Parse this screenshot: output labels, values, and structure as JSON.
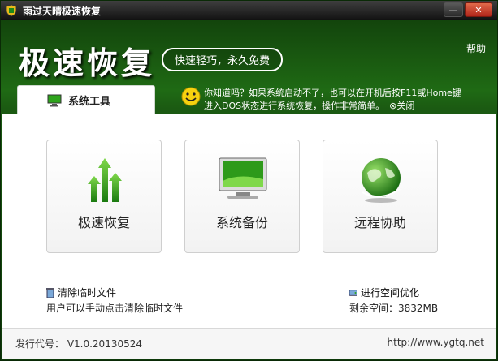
{
  "window": {
    "title": "雨过天晴极速恢复"
  },
  "header": {
    "brand": "极速恢复",
    "slogan": "快速轻巧，永久免费",
    "help": "帮助"
  },
  "tab": {
    "label": "系统工具"
  },
  "tip": {
    "line1": "你知道吗？如果系统启动不了，也可以在开机后按F11或Home键",
    "line2": "进入DOS状态进行系统恢复，操作非常简单。",
    "close": "⊗关闭"
  },
  "cards": [
    {
      "label": "极速恢复",
      "icon": "arrows-up-icon"
    },
    {
      "label": "系统备份",
      "icon": "computer-icon"
    },
    {
      "label": "远程协助",
      "icon": "globe-icon"
    }
  ],
  "cleanup": {
    "link": "清除临时文件",
    "desc": "用户可以手动点击清除临时文件"
  },
  "optimize": {
    "link": "进行空间优化",
    "space": "剩余空间：3832MB"
  },
  "footer": {
    "version": "发行代号： V1.0.20130524",
    "site": "http://www.ygtq.net"
  },
  "colors": {
    "bg": "#1b5a12",
    "accent": "#2ea41c"
  }
}
